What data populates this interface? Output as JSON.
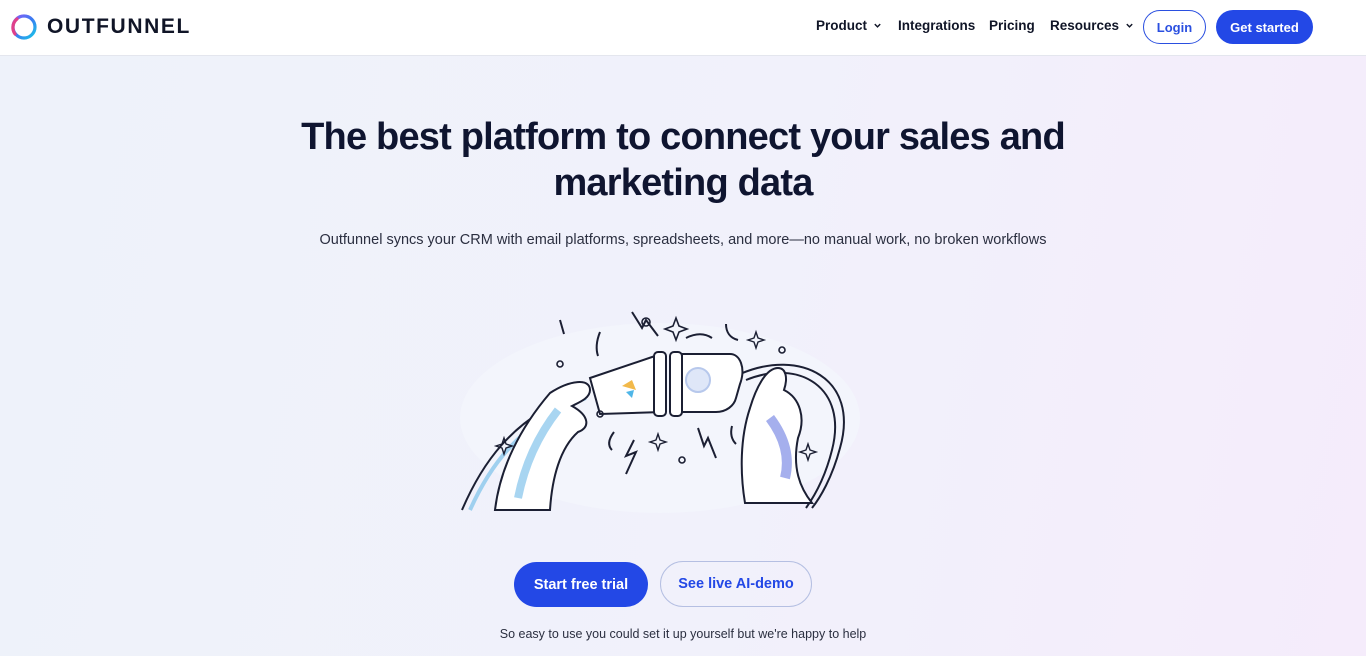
{
  "header": {
    "logo_text": "OUTFUNNEL",
    "nav": [
      {
        "label": "Product",
        "has_dropdown": true
      },
      {
        "label": "Integrations",
        "has_dropdown": false
      },
      {
        "label": "Pricing",
        "has_dropdown": false
      },
      {
        "label": "Resources",
        "has_dropdown": true
      }
    ],
    "login_label": "Login",
    "get_started_label": "Get started"
  },
  "hero": {
    "title_line1": "The best platform to connect your sales and",
    "title_line2": "marketing data",
    "subtitle": "Outfunnel syncs your CRM with email platforms, spreadsheets, and more—no manual work, no broken workflows",
    "illustration_icon": "connecting-plugs-illustration",
    "primary_cta": "Start free trial",
    "secondary_cta": "See live AI-demo",
    "note": "So easy to use you could set it up yourself but we're happy to help"
  },
  "colors": {
    "accent": "#2348e6",
    "text_dark": "#0f1530",
    "header_bg": "#ffffff"
  }
}
